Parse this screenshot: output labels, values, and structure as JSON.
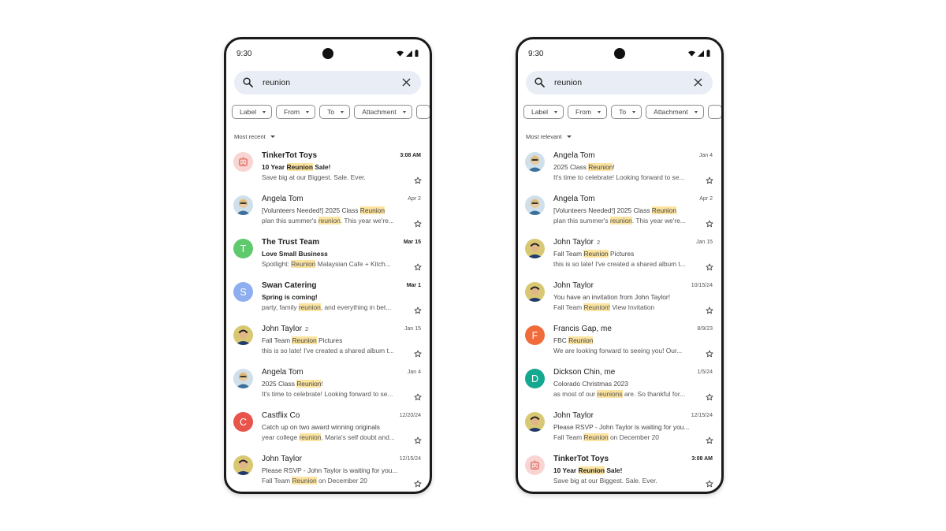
{
  "colors": {
    "highlight": "#fbe3a0",
    "search_bg": "#e9eef6",
    "avatar_robot_bg": "#f8d4d2",
    "avatar_robot_fg": "#e57368",
    "avatar_T": "#5fc96e",
    "avatar_S": "#8eaef0",
    "avatar_C": "#e8534a",
    "avatar_F": "#f06a3a",
    "avatar_D": "#14a891"
  },
  "phones": [
    {
      "status_time": "9:30",
      "search": {
        "query": "reunion",
        "icon": "search-icon",
        "clear_icon": "close-icon"
      },
      "chips": [
        {
          "label": "Label"
        },
        {
          "label": "From"
        },
        {
          "label": "To"
        },
        {
          "label": "Attachment"
        }
      ],
      "sort": "Most recent",
      "emails": [
        {
          "sender": "TinkerTot Toys",
          "count": "",
          "date": "3:08 AM",
          "unread": true,
          "avatar": {
            "type": "robot"
          },
          "subject": [
            {
              "t": "10 Year "
            },
            {
              "t": "Reunion",
              "h": true
            },
            {
              "t": " Sale!"
            }
          ],
          "snippet": [
            {
              "t": "Save big at our Biggest. Sale. Ever."
            }
          ]
        },
        {
          "sender": "Angela Tom",
          "count": "",
          "date": "Apr 2",
          "unread": false,
          "avatar": {
            "type": "photo-woman"
          },
          "subject": [
            {
              "t": "[Volunteers Needed!] 2025 Class "
            },
            {
              "t": "Reunion",
              "h": true
            }
          ],
          "snippet": [
            {
              "t": "plan this summer's "
            },
            {
              "t": "reunion",
              "h": true
            },
            {
              "t": ". This year we're..."
            }
          ]
        },
        {
          "sender": "The Trust Team",
          "count": "",
          "date": "Mar 15",
          "unread": true,
          "avatar": {
            "type": "letter",
            "letter": "T",
            "color": "#5fc96e"
          },
          "subject": [
            {
              "t": "Love Small Business"
            }
          ],
          "snippet": [
            {
              "t": "Spotlight: "
            },
            {
              "t": "Reunion",
              "h": true
            },
            {
              "t": " Malaysian Cafe + Kitch..."
            }
          ]
        },
        {
          "sender": "Swan Catering",
          "count": "",
          "date": "Mar 1",
          "unread": true,
          "avatar": {
            "type": "letter",
            "letter": "S",
            "color": "#8eaef0"
          },
          "subject": [
            {
              "t": "Spring is coming!"
            }
          ],
          "snippet": [
            {
              "t": "party, family "
            },
            {
              "t": "reunion",
              "h": true
            },
            {
              "t": ", and everything in bet..."
            }
          ]
        },
        {
          "sender": "John Taylor",
          "count": "2",
          "date": "Jan 15",
          "unread": false,
          "avatar": {
            "type": "photo-man"
          },
          "subject": [
            {
              "t": "Fall Team "
            },
            {
              "t": "Reunion",
              "h": true
            },
            {
              "t": " Pictures"
            }
          ],
          "snippet": [
            {
              "t": "this is so late!  I've created a shared album t..."
            }
          ]
        },
        {
          "sender": "Angela Tom",
          "count": "",
          "date": "Jan 4",
          "unread": false,
          "avatar": {
            "type": "photo-woman"
          },
          "subject": [
            {
              "t": "2025 Class "
            },
            {
              "t": "Reunion",
              "h": true
            },
            {
              "t": "!"
            }
          ],
          "snippet": [
            {
              "t": "It's time to celebrate!  Looking forward to se..."
            }
          ]
        },
        {
          "sender": "Castflix Co",
          "count": "",
          "date": "12/20/24",
          "unread": false,
          "avatar": {
            "type": "letter",
            "letter": "C",
            "color": "#e8534a"
          },
          "subject": [
            {
              "t": "Catch up on two award winning originals"
            }
          ],
          "snippet": [
            {
              "t": "year college "
            },
            {
              "t": "reunion",
              "h": true
            },
            {
              "t": ", Maria's self doubt and..."
            }
          ]
        },
        {
          "sender": "John Taylor",
          "count": "",
          "date": "12/15/24",
          "unread": false,
          "avatar": {
            "type": "photo-man"
          },
          "subject": [
            {
              "t": "Please RSVP - John Taylor is waiting for you..."
            }
          ],
          "snippet": [
            {
              "t": "Fall Team "
            },
            {
              "t": "Reunion",
              "h": true
            },
            {
              "t": " on December 20"
            }
          ]
        }
      ]
    },
    {
      "status_time": "9:30",
      "search": {
        "query": "reunion",
        "icon": "search-icon",
        "clear_icon": "close-icon"
      },
      "chips": [
        {
          "label": "Label"
        },
        {
          "label": "From"
        },
        {
          "label": "To"
        },
        {
          "label": "Attachment"
        }
      ],
      "sort": "Most relevant",
      "emails": [
        {
          "sender": "Angela Tom",
          "count": "",
          "date": "Jan 4",
          "unread": false,
          "avatar": {
            "type": "photo-woman"
          },
          "subject": [
            {
              "t": "2025 Class "
            },
            {
              "t": "Reunion",
              "h": true
            },
            {
              "t": "!"
            }
          ],
          "snippet": [
            {
              "t": "It's time to celebrate!  Looking forward to se..."
            }
          ]
        },
        {
          "sender": "Angela Tom",
          "count": "",
          "date": "Apr 2",
          "unread": false,
          "avatar": {
            "type": "photo-woman"
          },
          "subject": [
            {
              "t": "[Volunteers Needed!] 2025 Class "
            },
            {
              "t": "Reunion",
              "h": true
            }
          ],
          "snippet": [
            {
              "t": "plan this summer's "
            },
            {
              "t": "reunion",
              "h": true
            },
            {
              "t": ". This year we're..."
            }
          ]
        },
        {
          "sender": "John Taylor",
          "count": "2",
          "date": "Jan 15",
          "unread": false,
          "avatar": {
            "type": "photo-man"
          },
          "subject": [
            {
              "t": "Fall Team "
            },
            {
              "t": "Reunion",
              "h": true
            },
            {
              "t": " Pictures"
            }
          ],
          "snippet": [
            {
              "t": "this is so late!  I've created a shared album t..."
            }
          ]
        },
        {
          "sender": "John Taylor",
          "count": "",
          "date": "10/15/24",
          "unread": false,
          "avatar": {
            "type": "photo-man"
          },
          "subject": [
            {
              "t": "You have an invitation from John Taylor!"
            }
          ],
          "snippet": [
            {
              "t": "Fall Team "
            },
            {
              "t": "Reunion!",
              "h": true
            },
            {
              "t": " View Invitation"
            }
          ]
        },
        {
          "sender": "Francis Gap, me",
          "count": "",
          "date": "8/9/23",
          "unread": false,
          "avatar": {
            "type": "letter",
            "letter": "F",
            "color": "#f06a3a"
          },
          "subject": [
            {
              "t": "FBC "
            },
            {
              "t": "Reunion",
              "h": true
            }
          ],
          "snippet": [
            {
              "t": "We are looking forward to seeing you!  Our..."
            }
          ]
        },
        {
          "sender": "Dickson Chin, me",
          "count": "",
          "date": "1/5/24",
          "unread": false,
          "avatar": {
            "type": "letter",
            "letter": "D",
            "color": "#14a891"
          },
          "subject": [
            {
              "t": "Colorado Christmas 2023"
            }
          ],
          "snippet": [
            {
              "t": "as most of our "
            },
            {
              "t": "reunions",
              "h": true
            },
            {
              "t": " are.  So thankful for..."
            }
          ]
        },
        {
          "sender": "John Taylor",
          "count": "",
          "date": "12/15/24",
          "unread": false,
          "avatar": {
            "type": "photo-man"
          },
          "subject": [
            {
              "t": "Please RSVP - John Taylor is waiting for you..."
            }
          ],
          "snippet": [
            {
              "t": "Fall Team "
            },
            {
              "t": "Reunion",
              "h": true
            },
            {
              "t": " on December 20"
            }
          ]
        },
        {
          "sender": "TinkerTot Toys",
          "count": "",
          "date": "3:08 AM",
          "unread": true,
          "avatar": {
            "type": "robot"
          },
          "subject": [
            {
              "t": "10 Year "
            },
            {
              "t": "Reunion",
              "h": true
            },
            {
              "t": " Sale!"
            }
          ],
          "snippet": [
            {
              "t": "Save big at our Biggest. Sale. Ever."
            }
          ]
        }
      ]
    }
  ]
}
